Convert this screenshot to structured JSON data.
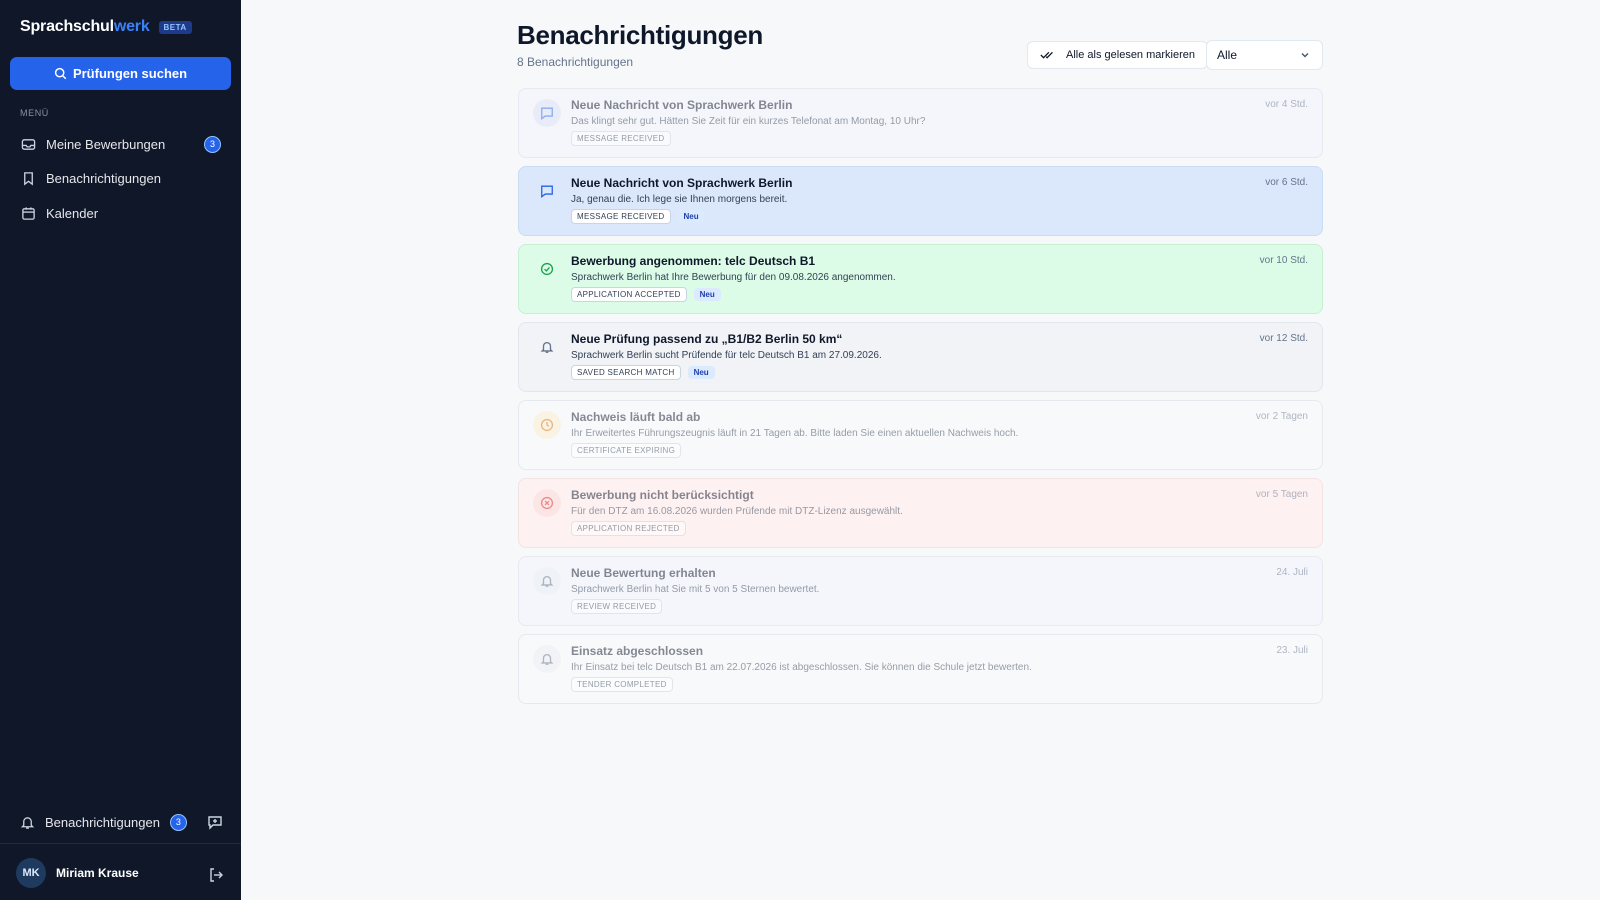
{
  "brand": {
    "part1": "Sprachschul",
    "part2": "werk",
    "beta": "BETA"
  },
  "sidebar": {
    "search_button": "Prüfungen suchen",
    "menu_label": "MENÜ",
    "items": [
      {
        "label": "Meine Bewerbungen",
        "icon": "inbox-icon",
        "badge": "3"
      },
      {
        "label": "Benachrichtigungen",
        "icon": "bookmark-icon"
      },
      {
        "label": "Kalender",
        "icon": "calendar-icon"
      }
    ],
    "bottom_notifications": {
      "label": "Benachrichtigungen",
      "badge": "3"
    },
    "user": {
      "initials": "MK",
      "name": "Miriam Krause"
    }
  },
  "header": {
    "title": "Benachrichtigungen",
    "subtitle": "8 Benachrichtigungen",
    "mark_all_read": "Alle als gelesen markieren",
    "filter_value": "Alle"
  },
  "notifications": [
    {
      "title": "Neue Nachricht von Sprachwerk Berlin",
      "desc": "Das klingt sehr gut. Hätten Sie Zeit für ein kurzes Telefonat am Montag, 10 Uhr?",
      "tag": "MESSAGE RECEIVED",
      "neu": "",
      "time": "vor 4 Std.",
      "icon": "message-icon",
      "read": true
    },
    {
      "title": "Neue Nachricht von Sprachwerk Berlin",
      "desc": "Ja, genau die. Ich lege sie Ihnen morgens bereit.",
      "tag": "MESSAGE RECEIVED",
      "neu": "Neu",
      "time": "vor 6 Std.",
      "icon": "message-icon",
      "read": false
    },
    {
      "title": "Bewerbung angenommen: telc Deutsch B1",
      "desc": "Sprachwerk Berlin hat Ihre Bewerbung für den 09.08.2026 angenommen.",
      "tag": "APPLICATION ACCEPTED",
      "neu": "Neu",
      "time": "vor 10 Std.",
      "icon": "check-circle-icon",
      "read": false
    },
    {
      "title": "Neue Prüfung passend zu „B1/B2 Berlin 50 km“",
      "desc": "Sprachwerk Berlin sucht Prüfende für telc Deutsch B1 am 27.09.2026.",
      "tag": "SAVED SEARCH MATCH",
      "neu": "Neu",
      "time": "vor 12 Std.",
      "icon": "bell-icon",
      "read": false
    },
    {
      "title": "Nachweis läuft bald ab",
      "desc": "Ihr Erweitertes Führungszeugnis läuft in 21 Tagen ab. Bitte laden Sie einen aktuellen Nachweis hoch.",
      "tag": "CERTIFICATE EXPIRING",
      "neu": "",
      "time": "vor 2 Tagen",
      "icon": "clock-icon",
      "read": true
    },
    {
      "title": "Bewerbung nicht berücksichtigt",
      "desc": "Für den DTZ am 16.08.2026 wurden Prüfende mit DTZ-Lizenz ausgewählt.",
      "tag": "APPLICATION REJECTED",
      "neu": "",
      "time": "vor 5 Tagen",
      "icon": "x-circle-icon",
      "read": true
    },
    {
      "title": "Neue Bewertung erhalten",
      "desc": "Sprachwerk Berlin hat Sie mit 5 von 5 Sternen bewertet.",
      "tag": "REVIEW RECEIVED",
      "neu": "",
      "time": "24. Juli",
      "icon": "bell-icon",
      "read": true
    },
    {
      "title": "Einsatz abgeschlossen",
      "desc": "Ihr Einsatz bei telc Deutsch B1 am 22.07.2026 ist abgeschlossen. Sie können die Schule jetzt bewerten.",
      "tag": "TENDER COMPLETED",
      "neu": "",
      "time": "23. Juli",
      "icon": "bell-icon",
      "read": true
    }
  ],
  "colors": {
    "sidebar_bg": "#0f1729",
    "accent": "#2563eb",
    "card_message_bg": "#dbe8fb",
    "card_accepted_bg": "#dcfce7",
    "card_match_bg": "#f1f3f7",
    "card_rejected_bg": "#fdf1f1",
    "card_default_bg": "#f4f6fb"
  }
}
